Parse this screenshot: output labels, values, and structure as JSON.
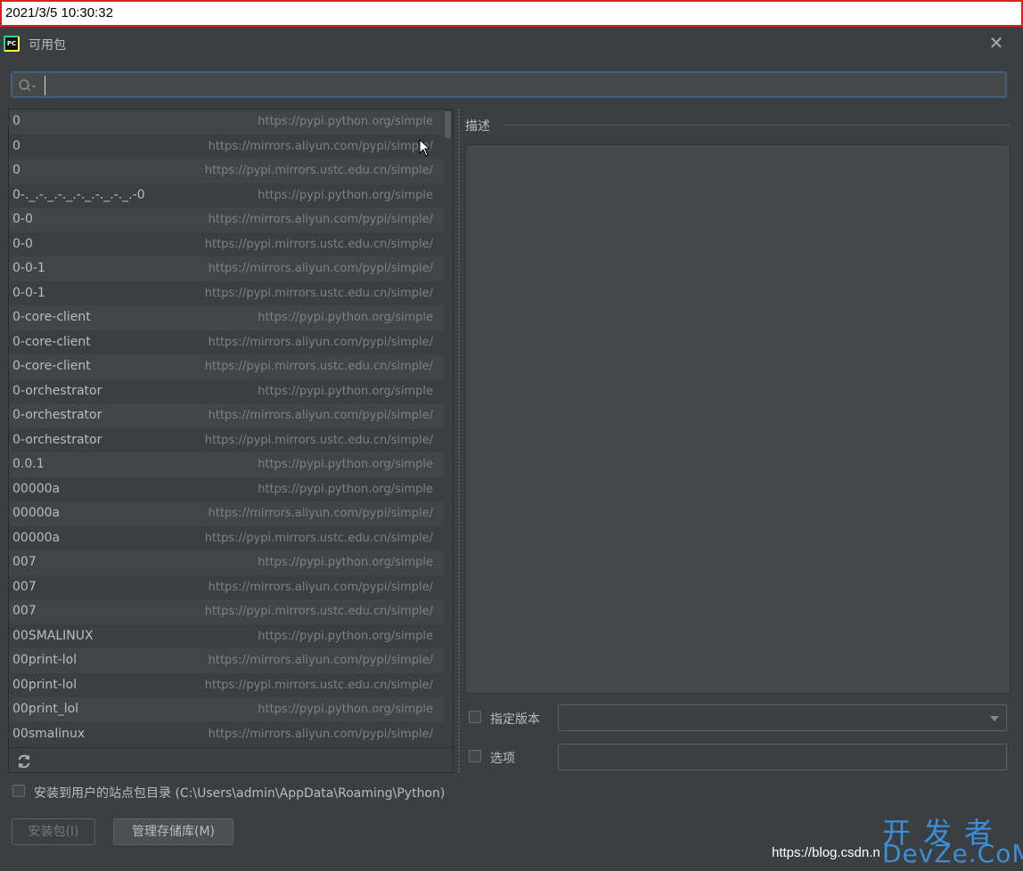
{
  "timestamp": "2021/3/5 10:30:32",
  "window": {
    "title": "可用包",
    "icon_text": "PC"
  },
  "search": {
    "value": "",
    "placeholder": ""
  },
  "packages": [
    {
      "name": "0",
      "repo": "https://pypi.python.org/simple"
    },
    {
      "name": "0",
      "repo": "https://mirrors.aliyun.com/pypi/simple/"
    },
    {
      "name": "0",
      "repo": "https://pypi.mirrors.ustc.edu.cn/simple/"
    },
    {
      "name": "0-._.-._.-._.-._.-._.-._.-0",
      "repo": "https://pypi.python.org/simple"
    },
    {
      "name": "0-0",
      "repo": "https://mirrors.aliyun.com/pypi/simple/"
    },
    {
      "name": "0-0",
      "repo": "https://pypi.mirrors.ustc.edu.cn/simple/"
    },
    {
      "name": "0-0-1",
      "repo": "https://mirrors.aliyun.com/pypi/simple/"
    },
    {
      "name": "0-0-1",
      "repo": "https://pypi.mirrors.ustc.edu.cn/simple/"
    },
    {
      "name": "0-core-client",
      "repo": "https://pypi.python.org/simple"
    },
    {
      "name": "0-core-client",
      "repo": "https://mirrors.aliyun.com/pypi/simple/"
    },
    {
      "name": "0-core-client",
      "repo": "https://pypi.mirrors.ustc.edu.cn/simple/"
    },
    {
      "name": "0-orchestrator",
      "repo": "https://pypi.python.org/simple"
    },
    {
      "name": "0-orchestrator",
      "repo": "https://mirrors.aliyun.com/pypi/simple/"
    },
    {
      "name": "0-orchestrator",
      "repo": "https://pypi.mirrors.ustc.edu.cn/simple/"
    },
    {
      "name": "0.0.1",
      "repo": "https://pypi.python.org/simple"
    },
    {
      "name": "00000a",
      "repo": "https://pypi.python.org/simple"
    },
    {
      "name": "00000a",
      "repo": "https://mirrors.aliyun.com/pypi/simple/"
    },
    {
      "name": "00000a",
      "repo": "https://pypi.mirrors.ustc.edu.cn/simple/"
    },
    {
      "name": "007",
      "repo": "https://pypi.python.org/simple"
    },
    {
      "name": "007",
      "repo": "https://mirrors.aliyun.com/pypi/simple/"
    },
    {
      "name": "007",
      "repo": "https://pypi.mirrors.ustc.edu.cn/simple/"
    },
    {
      "name": "00SMALINUX",
      "repo": "https://pypi.python.org/simple"
    },
    {
      "name": "00print-lol",
      "repo": "https://mirrors.aliyun.com/pypi/simple/"
    },
    {
      "name": "00print-lol",
      "repo": "https://pypi.mirrors.ustc.edu.cn/simple/"
    },
    {
      "name": "00print_lol",
      "repo": "https://pypi.python.org/simple"
    },
    {
      "name": "00smalinux",
      "repo": "https://mirrors.aliyun.com/pypi/simple/"
    }
  ],
  "description": {
    "label": "描述",
    "content": ""
  },
  "options": {
    "specify_version_label": "指定版本",
    "specify_version_checked": false,
    "version_value": "",
    "options_label": "选项",
    "options_checked": false,
    "options_value": ""
  },
  "user_site": {
    "label": "安装到用户的站点包目录 (C:\\Users\\admin\\AppData\\Roaming\\Python)",
    "checked": false
  },
  "buttons": {
    "install": "安装包(I)",
    "manage": "管理存储库(M)"
  },
  "watermark": {
    "url": "https://blog.csdn.n",
    "logo_top": "开发者",
    "logo_bottom": "DevZe.CoM"
  },
  "colors": {
    "background": "#3c3f41",
    "accent_border": "#3d6185",
    "timestamp_border": "#e02020",
    "watermark_blue": "#3a8edc"
  }
}
